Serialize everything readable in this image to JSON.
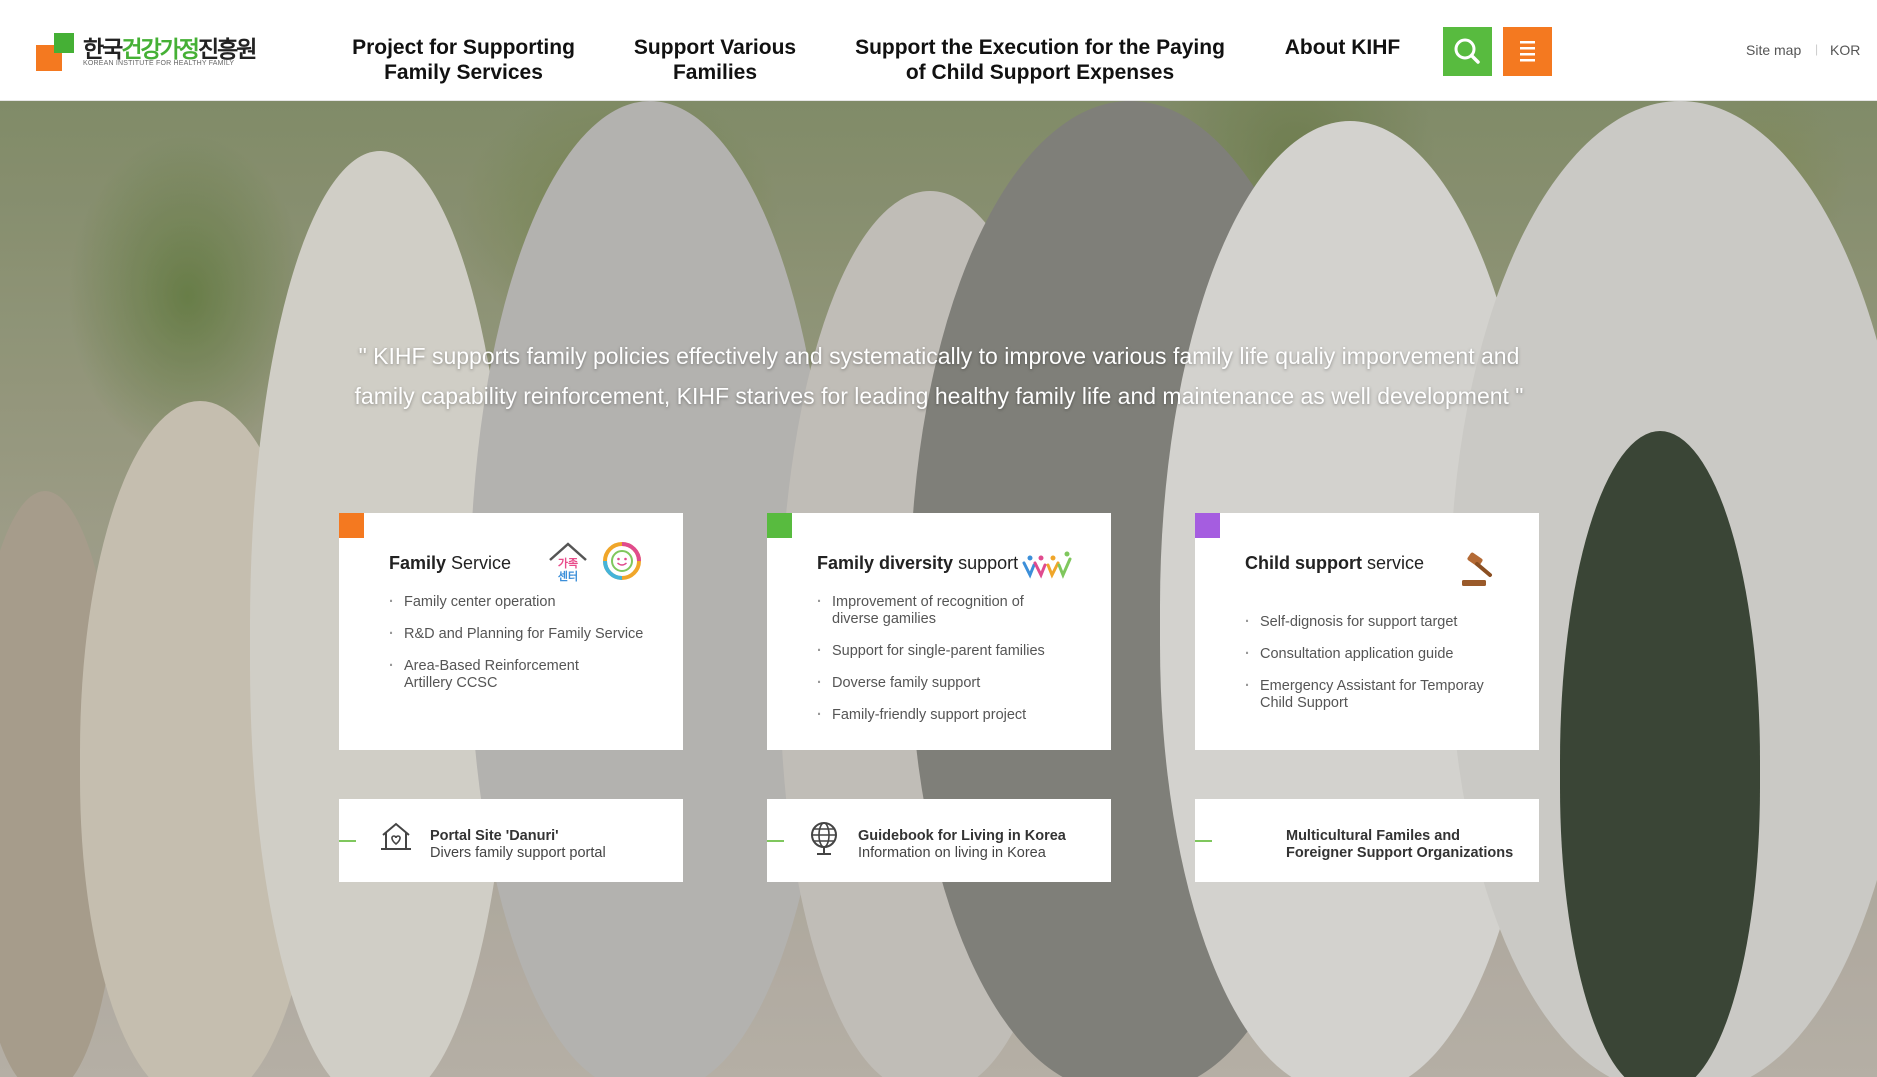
{
  "header": {
    "logo_korean_parts": [
      "한국",
      "건강가정",
      "진흥원"
    ],
    "logo_english": "KOREAN INSTITUTE FOR HEALTHY FAMILY",
    "nav": [
      {
        "line1": "Project for Supporting",
        "line2": "Family Services"
      },
      {
        "line1": "Support Various",
        "line2": "Families"
      },
      {
        "line1": "Support the Execution for the Paying",
        "line2": "of Child Support Expenses"
      },
      {
        "line1": "About KIHF",
        "line2": ""
      }
    ],
    "search_icon": "search-icon",
    "menu_icon": "menu-icon",
    "util": {
      "sitemap": "Site map",
      "separator": "|",
      "lang": "KOR"
    }
  },
  "hero": {
    "quote_line1": "\" KIHF supports family policies effectively and systematically to improve various family life qualiy imporvement and",
    "quote_line2": "family capability reinforcement, KIHF starives for leading healthy family life and maintenance as well development \""
  },
  "cards": [
    {
      "title_bold": "Family",
      "title_rest": " Service",
      "corner_color": "#f47920",
      "icon_text_1": "가족",
      "icon_text_2": "센터",
      "items": [
        {
          "l1": "Family center operation",
          "l2": ""
        },
        {
          "l1": "R&D and Planning for Family Service",
          "l2": ""
        },
        {
          "l1": "Area-Based Reinforcement",
          "l2": "Artillery CCSC"
        }
      ]
    },
    {
      "title_bold": "Family diversity",
      "title_rest": " support",
      "corner_color": "#58bb3f",
      "items": [
        {
          "l1": "Improvement of recognition of",
          "l2": "diverse gamilies"
        },
        {
          "l1": "Support for single-parent families",
          "l2": ""
        },
        {
          "l1": "Doverse family support",
          "l2": ""
        },
        {
          "l1": "Family-friendly support project",
          "l2": ""
        }
      ]
    },
    {
      "title_bold": "Child support",
      "title_rest": " service",
      "corner_color": "#a55de0",
      "items": [
        {
          "l1": "Self-dignosis for support target",
          "l2": ""
        },
        {
          "l1": "Consultation application guide",
          "l2": ""
        },
        {
          "l1": "Emergency Assistant for Temporay",
          "l2": "Child Support"
        }
      ]
    }
  ],
  "links": [
    {
      "title": "Portal Site 'Danuri'",
      "sub": "Divers family support portal",
      "icon": "house-heart-icon"
    },
    {
      "title": "Guidebook for Living in Korea",
      "sub": "Information on living in Korea",
      "icon": "globe-icon"
    },
    {
      "title": "Multicultural Familes and",
      "title2": "Foreigner Support Organizations"
    }
  ],
  "colors": {
    "green": "#58bb3f",
    "orange": "#f47920",
    "purple": "#a55de0"
  }
}
